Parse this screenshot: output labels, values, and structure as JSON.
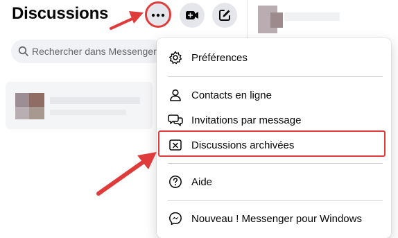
{
  "header": {
    "title": "Discussions"
  },
  "toolbar": {
    "more_icon": "ellipsis-icon",
    "video_icon": "video-plus-icon",
    "compose_icon": "compose-icon"
  },
  "search": {
    "placeholder": "Rechercher dans Messenger"
  },
  "menu": {
    "preferences": "Préférences",
    "contacts": "Contacts en ligne",
    "invitations": "Invitations par message",
    "archived": "Discussions archivées",
    "help": "Aide",
    "windows": "Nouveau ! Messenger pour Windows"
  },
  "colors": {
    "annotation": "#e03b3b",
    "button_bg": "#e4e6eb",
    "search_bg": "#f0f2f5"
  }
}
